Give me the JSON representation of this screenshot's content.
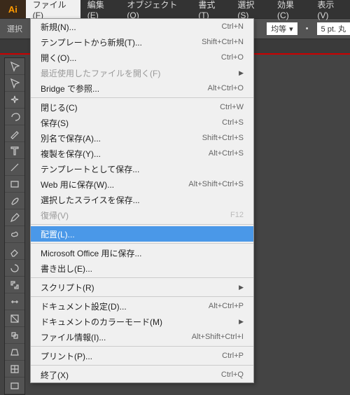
{
  "app": {
    "logo": "Ai"
  },
  "menubar": [
    "ファイル(F)",
    "編集(E)",
    "オブジェクト(O)",
    "書式(T)",
    "選択(S)",
    "効果(C)",
    "表示(V)"
  ],
  "control_bar": {
    "label": "選択",
    "align_value": "均等",
    "stroke_value": "5 pt. 丸"
  },
  "file_menu": [
    [
      {
        "label": "新規(N)...",
        "shortcut": "Ctrl+N"
      },
      {
        "label": "テンプレートから新規(T)...",
        "shortcut": "Shift+Ctrl+N"
      },
      {
        "label": "開く(O)...",
        "shortcut": "Ctrl+O"
      },
      {
        "label": "最近使用したファイルを開く(F)",
        "submenu": true,
        "disabled": true
      },
      {
        "label": "Bridge で参照...",
        "shortcut": "Alt+Ctrl+O"
      }
    ],
    [
      {
        "label": "閉じる(C)",
        "shortcut": "Ctrl+W"
      },
      {
        "label": "保存(S)",
        "shortcut": "Ctrl+S"
      },
      {
        "label": "別名で保存(A)...",
        "shortcut": "Shift+Ctrl+S"
      },
      {
        "label": "複製を保存(Y)...",
        "shortcut": "Alt+Ctrl+S"
      },
      {
        "label": "テンプレートとして保存..."
      },
      {
        "label": "Web 用に保存(W)...",
        "shortcut": "Alt+Shift+Ctrl+S"
      },
      {
        "label": "選択したスライスを保存..."
      },
      {
        "label": "復帰(V)",
        "shortcut": "F12",
        "disabled": true
      }
    ],
    [
      {
        "label": "配置(L)...",
        "highlight": true
      }
    ],
    [
      {
        "label": "Microsoft Office 用に保存..."
      },
      {
        "label": "書き出し(E)..."
      }
    ],
    [
      {
        "label": "スクリプト(R)",
        "submenu": true
      }
    ],
    [
      {
        "label": "ドキュメント設定(D)...",
        "shortcut": "Alt+Ctrl+P"
      },
      {
        "label": "ドキュメントのカラーモード(M)",
        "submenu": true
      },
      {
        "label": "ファイル情報(I)...",
        "shortcut": "Alt+Shift+Ctrl+I"
      }
    ],
    [
      {
        "label": "プリント(P)...",
        "shortcut": "Ctrl+P"
      }
    ],
    [
      {
        "label": "終了(X)",
        "shortcut": "Ctrl+Q"
      }
    ]
  ],
  "tools": [
    "selection",
    "direct-selection",
    "magic-wand",
    "lasso",
    "pen",
    "type",
    "line",
    "rectangle",
    "brush",
    "pencil",
    "blob-brush",
    "eraser",
    "rotate",
    "scale",
    "width",
    "free-transform",
    "shape-builder",
    "perspective",
    "mesh",
    "gradient"
  ]
}
